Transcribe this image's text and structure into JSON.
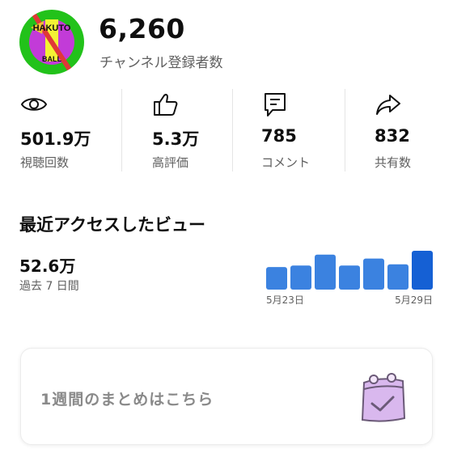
{
  "channel": {
    "avatar_text_top": "HAKUTO",
    "avatar_text_bottom": "BALL",
    "subscriber_count": "6,260",
    "subscriber_label": "チャンネル登録者数"
  },
  "stats": [
    {
      "icon": "eye-icon",
      "value": "501.9万",
      "label": "視聴回数"
    },
    {
      "icon": "thumbs-up-icon",
      "value": "5.3万",
      "label": "高評価"
    },
    {
      "icon": "comment-icon",
      "value": "785",
      "label": "コメント"
    },
    {
      "icon": "share-icon",
      "value": "832",
      "label": "共有数"
    }
  ],
  "recent": {
    "title": "最近アクセスしたビュー",
    "value": "52.6万",
    "period_label": "過去 7 日間"
  },
  "chart_data": {
    "type": "bar",
    "categories": [
      "5月23日",
      "",
      "",
      "",
      "",
      "",
      "5月29日"
    ],
    "values": [
      0.58,
      0.62,
      0.9,
      0.62,
      0.8,
      0.65,
      1.0
    ],
    "ylim": [
      0,
      1
    ],
    "grid": false,
    "colors": {
      "default": "#3b82e0",
      "highlight": "#1560d4"
    }
  },
  "summary_card": {
    "text": "1週間のまとめはこちら",
    "icon": "calendar-check-icon"
  }
}
